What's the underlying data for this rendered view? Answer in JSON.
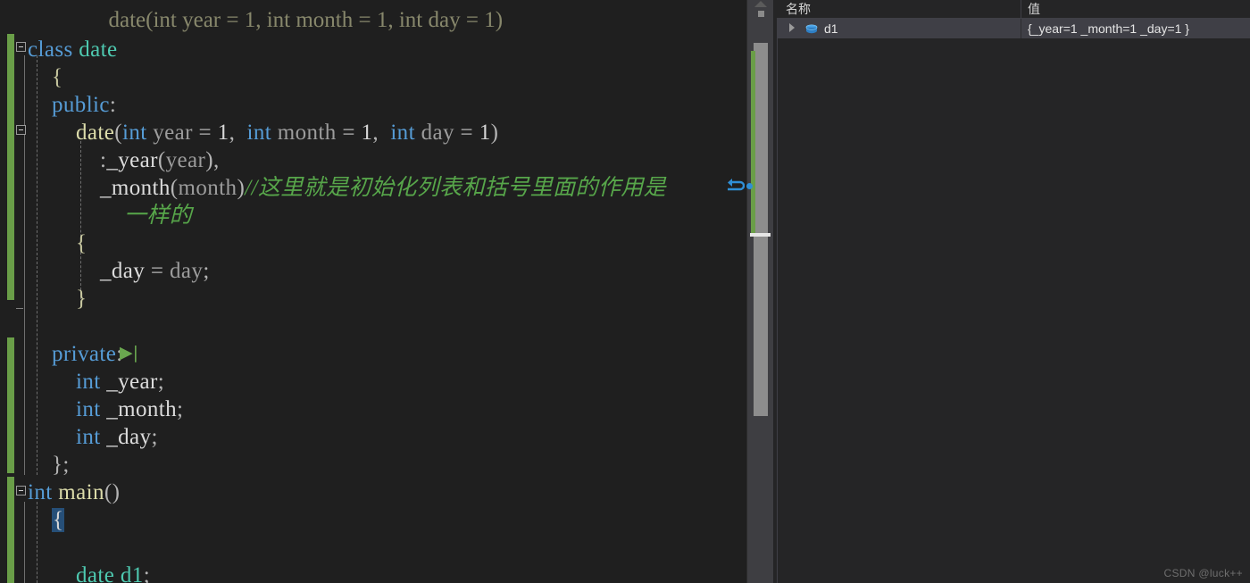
{
  "theme": {
    "editor_background": "#1f1f1f",
    "panel_background": "#252526",
    "keyword_color": "#569cd6",
    "type_color": "#4ec9b0",
    "function_color": "#dcdcaa",
    "comment_color": "#57a64a",
    "plain_color": "#dcdcdc",
    "parameter_color": "#9c9c9c",
    "selection_color": "#264f78",
    "change_bar_color": "#6a9e48",
    "row_selected_color": "#3f3f46"
  },
  "editor": {
    "language": "C++",
    "ghost_line": "date(int year = 1, int month = 1, int day = 1)",
    "lines": [
      {
        "id": "line-class-date",
        "indent": 0,
        "tokens": [
          {
            "text": "class",
            "kind": "keyword"
          },
          {
            "text": " ",
            "kind": "plain"
          },
          {
            "text": "date",
            "kind": "type"
          }
        ]
      },
      {
        "id": "line-class-open-brace",
        "indent": 1,
        "tokens": [
          {
            "text": "{",
            "kind": "brace"
          }
        ]
      },
      {
        "id": "line-public",
        "indent": 1,
        "tokens": [
          {
            "text": "public",
            "kind": "keyword"
          },
          {
            "text": ":",
            "kind": "punct"
          }
        ]
      },
      {
        "id": "line-ctor-signature",
        "indent": 2,
        "tokens": [
          {
            "text": "date",
            "kind": "function"
          },
          {
            "text": "(",
            "kind": "punct"
          },
          {
            "text": "int",
            "kind": "keyword"
          },
          {
            "text": " year ",
            "kind": "parameter"
          },
          {
            "text": "= ",
            "kind": "punct"
          },
          {
            "text": "1",
            "kind": "number"
          },
          {
            "text": ",  ",
            "kind": "punct"
          },
          {
            "text": "int",
            "kind": "keyword"
          },
          {
            "text": " month ",
            "kind": "parameter"
          },
          {
            "text": "= ",
            "kind": "punct"
          },
          {
            "text": "1",
            "kind": "number"
          },
          {
            "text": ",  ",
            "kind": "punct"
          },
          {
            "text": "int",
            "kind": "keyword"
          },
          {
            "text": " day ",
            "kind": "parameter"
          },
          {
            "text": "= ",
            "kind": "punct"
          },
          {
            "text": "1",
            "kind": "number"
          },
          {
            "text": ")",
            "kind": "punct"
          }
        ]
      },
      {
        "id": "line-init-year",
        "indent": 3,
        "tokens": [
          {
            "text": ":",
            "kind": "punct"
          },
          {
            "text": "_year",
            "kind": "plain"
          },
          {
            "text": "(",
            "kind": "punct"
          },
          {
            "text": "year",
            "kind": "parameter"
          },
          {
            "text": "),",
            "kind": "punct"
          }
        ]
      },
      {
        "id": "line-init-month-with-comment",
        "indent": 3,
        "tokens": [
          {
            "text": "_month",
            "kind": "plain"
          },
          {
            "text": "(",
            "kind": "punct"
          },
          {
            "text": "month",
            "kind": "parameter"
          },
          {
            "text": ")",
            "kind": "punct"
          },
          {
            "text": "//这里就是初始化列表和括号里面的作用是",
            "kind": "comment"
          }
        ]
      },
      {
        "id": "line-comment-wrap-continuation",
        "indent": 4,
        "tokens": [
          {
            "text": "一样的",
            "kind": "comment"
          }
        ]
      },
      {
        "id": "line-ctor-open-brace",
        "indent": 2,
        "tokens": [
          {
            "text": "{",
            "kind": "brace"
          }
        ]
      },
      {
        "id": "line-assign-day",
        "indent": 3,
        "tokens": [
          {
            "text": "_day",
            "kind": "plain"
          },
          {
            "text": " = ",
            "kind": "punct"
          },
          {
            "text": "day",
            "kind": "parameter"
          },
          {
            "text": ";",
            "kind": "punct"
          }
        ]
      },
      {
        "id": "line-ctor-close-brace",
        "indent": 2,
        "tokens": [
          {
            "text": "}",
            "kind": "brace"
          }
        ]
      },
      {
        "id": "line-blank-1",
        "indent": 0,
        "tokens": []
      },
      {
        "id": "line-private",
        "indent": 1,
        "tokens": [
          {
            "text": "private",
            "kind": "keyword"
          },
          {
            "text": ":",
            "kind": "punct"
          }
        ]
      },
      {
        "id": "line-member-year",
        "indent": 2,
        "tokens": [
          {
            "text": "int",
            "kind": "keyword"
          },
          {
            "text": " ",
            "kind": "plain"
          },
          {
            "text": "_year",
            "kind": "plain"
          },
          {
            "text": ";",
            "kind": "punct"
          }
        ]
      },
      {
        "id": "line-member-month",
        "indent": 2,
        "tokens": [
          {
            "text": "int",
            "kind": "keyword"
          },
          {
            "text": " ",
            "kind": "plain"
          },
          {
            "text": "_month",
            "kind": "plain"
          },
          {
            "text": ";",
            "kind": "punct"
          }
        ]
      },
      {
        "id": "line-member-day",
        "indent": 2,
        "tokens": [
          {
            "text": "int",
            "kind": "keyword"
          },
          {
            "text": " ",
            "kind": "plain"
          },
          {
            "text": "_day",
            "kind": "plain"
          },
          {
            "text": ";",
            "kind": "punct"
          }
        ]
      },
      {
        "id": "line-class-close",
        "indent": 1,
        "tokens": [
          {
            "text": "};",
            "kind": "punct"
          }
        ]
      },
      {
        "id": "line-main-signature",
        "indent": 0,
        "tokens": [
          {
            "text": "int",
            "kind": "keyword"
          },
          {
            "text": " ",
            "kind": "plain"
          },
          {
            "text": "main",
            "kind": "function"
          },
          {
            "text": "()",
            "kind": "punct"
          }
        ]
      },
      {
        "id": "line-main-open-brace",
        "indent": 1,
        "tokens": [
          {
            "text": "{",
            "kind": "selected-brace"
          }
        ]
      },
      {
        "id": "line-blank-2",
        "indent": 0,
        "tokens": []
      },
      {
        "id": "line-declare-d1",
        "indent": 2,
        "tokens": [
          {
            "text": "date",
            "kind": "type"
          },
          {
            "text": " ",
            "kind": "plain"
          },
          {
            "text": "d1",
            "kind": "type"
          },
          {
            "text": ";",
            "kind": "punct"
          }
        ]
      }
    ],
    "wrap_arrow_glyph": "↵",
    "step_glyph": "▶|",
    "collapse_glyph": "⊟"
  },
  "scrollbar": {
    "up_arrow": "scroll-up-arrow",
    "bookmark_marker": "bookmark-marker",
    "caret_marker": "caret-position-marker",
    "change_marker": "unsaved-changes-marker",
    "breakpoint_marker": "breakpoint-marker"
  },
  "watch_panel": {
    "columns": [
      {
        "id": "name",
        "label": "名称"
      },
      {
        "id": "value",
        "label": "值"
      }
    ],
    "rows": [
      {
        "expander": "▶",
        "icon": "object-variable-icon",
        "name": "d1",
        "value": "{_year=1 _month=1 _day=1 }",
        "selected": true
      }
    ]
  },
  "watermark": {
    "text": "CSDN @luck++"
  }
}
